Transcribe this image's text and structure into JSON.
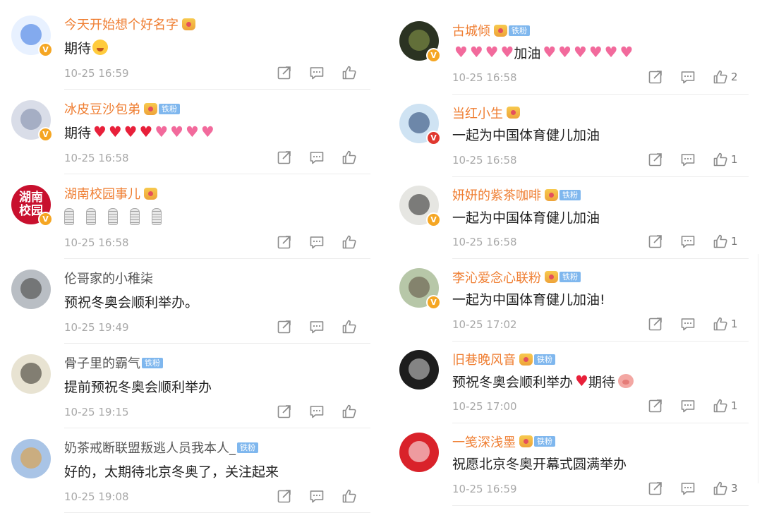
{
  "left": [
    {
      "username": "今天开始想个好名字",
      "name_color": "orange",
      "has_crown": true,
      "fan_badge": "",
      "verified": "v",
      "avatar": {
        "kind": "blue-mascot",
        "bg": "#e8f1ff",
        "fg": "#2f6fe0"
      },
      "segments": [
        {
          "t": "text",
          "v": "期待"
        },
        {
          "t": "face"
        }
      ],
      "timestamp": "10-25 16:59",
      "likes": ""
    },
    {
      "username": "冰皮豆沙包弟",
      "name_color": "orange",
      "has_crown": true,
      "fan_badge": "铁粉",
      "verified": "v",
      "avatar": {
        "kind": "anime-boy",
        "bg": "#d9dde8",
        "fg": "#7a86a6"
      },
      "segments": [
        {
          "t": "text",
          "v": "期待"
        },
        {
          "t": "heart"
        },
        {
          "t": "heart"
        },
        {
          "t": "heart"
        },
        {
          "t": "heart"
        },
        {
          "t": "pheart"
        },
        {
          "t": "pheart"
        },
        {
          "t": "pheart"
        },
        {
          "t": "pheart"
        }
      ],
      "timestamp": "10-25 16:58",
      "likes": ""
    },
    {
      "username": "湖南校园事儿",
      "name_color": "orange",
      "has_crown": true,
      "fan_badge": "",
      "verified": "v",
      "avatar": {
        "kind": "text",
        "bg": "#c8102e",
        "fg": "#ffffff",
        "text": "湖南 校园"
      },
      "segments": [
        {
          "t": "mic"
        },
        {
          "t": "mic"
        },
        {
          "t": "mic"
        },
        {
          "t": "mic"
        },
        {
          "t": "mic"
        }
      ],
      "timestamp": "10-25 16:58",
      "likes": ""
    },
    {
      "username": "伦哥家的小稚柒",
      "name_color": "gray",
      "has_crown": false,
      "fan_badge": "",
      "verified": "",
      "avatar": {
        "kind": "photo",
        "bg": "#b9bec4",
        "fg": "#3d3a38"
      },
      "segments": [
        {
          "t": "text",
          "v": "预祝冬奥会顺利举办。"
        }
      ],
      "timestamp": "10-25 19:49",
      "likes": ""
    },
    {
      "username": "骨子里的霸气",
      "name_color": "gray",
      "has_crown": false,
      "fan_badge": "铁粉",
      "verified": "",
      "avatar": {
        "kind": "ink",
        "bg": "#e8e3d2",
        "fg": "#2e2b22"
      },
      "segments": [
        {
          "t": "text",
          "v": "提前预祝冬奥会顺利举办"
        }
      ],
      "timestamp": "10-25 19:15",
      "likes": ""
    },
    {
      "username": "奶茶戒断联盟叛逃人员我本人_",
      "name_color": "gray",
      "has_crown": false,
      "fan_badge": "铁粉",
      "verified": "",
      "avatar": {
        "kind": "tiger",
        "bg": "#a9c4e6",
        "fg": "#e59a2c"
      },
      "segments": [
        {
          "t": "text",
          "v": "好的，太期待北京冬奥了，关注起来"
        }
      ],
      "timestamp": "10-25 19:08",
      "likes": ""
    }
  ],
  "right": [
    {
      "username": "古城倾",
      "name_color": "orange",
      "has_crown": true,
      "fan_badge": "铁粉",
      "verified": "v",
      "avatar": {
        "kind": "dark",
        "bg": "#2b3322",
        "fg": "#8fa04c"
      },
      "segments": [
        {
          "t": "pheart"
        },
        {
          "t": "pheart"
        },
        {
          "t": "pheart"
        },
        {
          "t": "pheart"
        },
        {
          "t": "text",
          "v": "加油"
        },
        {
          "t": "pheart"
        },
        {
          "t": "pheart"
        },
        {
          "t": "pheart"
        },
        {
          "t": "pheart"
        },
        {
          "t": "pheart"
        },
        {
          "t": "pheart"
        }
      ],
      "timestamp": "10-25 16:58",
      "likes": "2"
    },
    {
      "username": "当红小生",
      "name_color": "orange",
      "has_crown": true,
      "fan_badge": "",
      "verified": "red",
      "avatar": {
        "kind": "cartoon",
        "bg": "#cfe3f3",
        "fg": "#1e3d6b"
      },
      "segments": [
        {
          "t": "text",
          "v": "一起为中国体育健儿加油"
        }
      ],
      "timestamp": "10-25 16:58",
      "likes": "1"
    },
    {
      "username": "妍妍的紫茶咖啡",
      "name_color": "orange",
      "has_crown": true,
      "fan_badge": "铁粉",
      "verified": "v",
      "avatar": {
        "kind": "sketch",
        "bg": "#e6e6e2",
        "fg": "#222222"
      },
      "segments": [
        {
          "t": "text",
          "v": "一起为中国体育健儿加油"
        }
      ],
      "timestamp": "10-25 16:58",
      "likes": "1"
    },
    {
      "username": "李沁爱念心联粉",
      "name_color": "orange",
      "has_crown": true,
      "fan_badge": "铁粉",
      "verified": "v",
      "avatar": {
        "kind": "portrait",
        "bg": "#b7c7a8",
        "fg": "#5b4a3c"
      },
      "segments": [
        {
          "t": "text",
          "v": "一起为中国体育健儿加油!"
        }
      ],
      "timestamp": "10-25 17:02",
      "likes": "1"
    },
    {
      "username": "旧巷晚风音",
      "name_color": "orange",
      "has_crown": true,
      "fan_badge": "铁粉",
      "verified": "",
      "avatar": {
        "kind": "silhouette",
        "bg": "#1d1d1d",
        "fg": "#d9d9d9"
      },
      "segments": [
        {
          "t": "text",
          "v": "预祝冬奥会顺利举办"
        },
        {
          "t": "heart"
        },
        {
          "t": "text",
          "v": "期待"
        },
        {
          "t": "pig"
        }
      ],
      "timestamp": "10-25 17:00",
      "likes": "1"
    },
    {
      "username": "一笺深浅墨",
      "name_color": "orange",
      "has_crown": true,
      "fan_badge": "铁粉",
      "verified": "",
      "avatar": {
        "kind": "rabbit",
        "bg": "#d9222a",
        "fg": "#ffffff"
      },
      "segments": [
        {
          "t": "text",
          "v": "祝愿北京冬奥开幕式圆满举办"
        }
      ],
      "timestamp": "10-25 16:59",
      "likes": "3"
    }
  ]
}
